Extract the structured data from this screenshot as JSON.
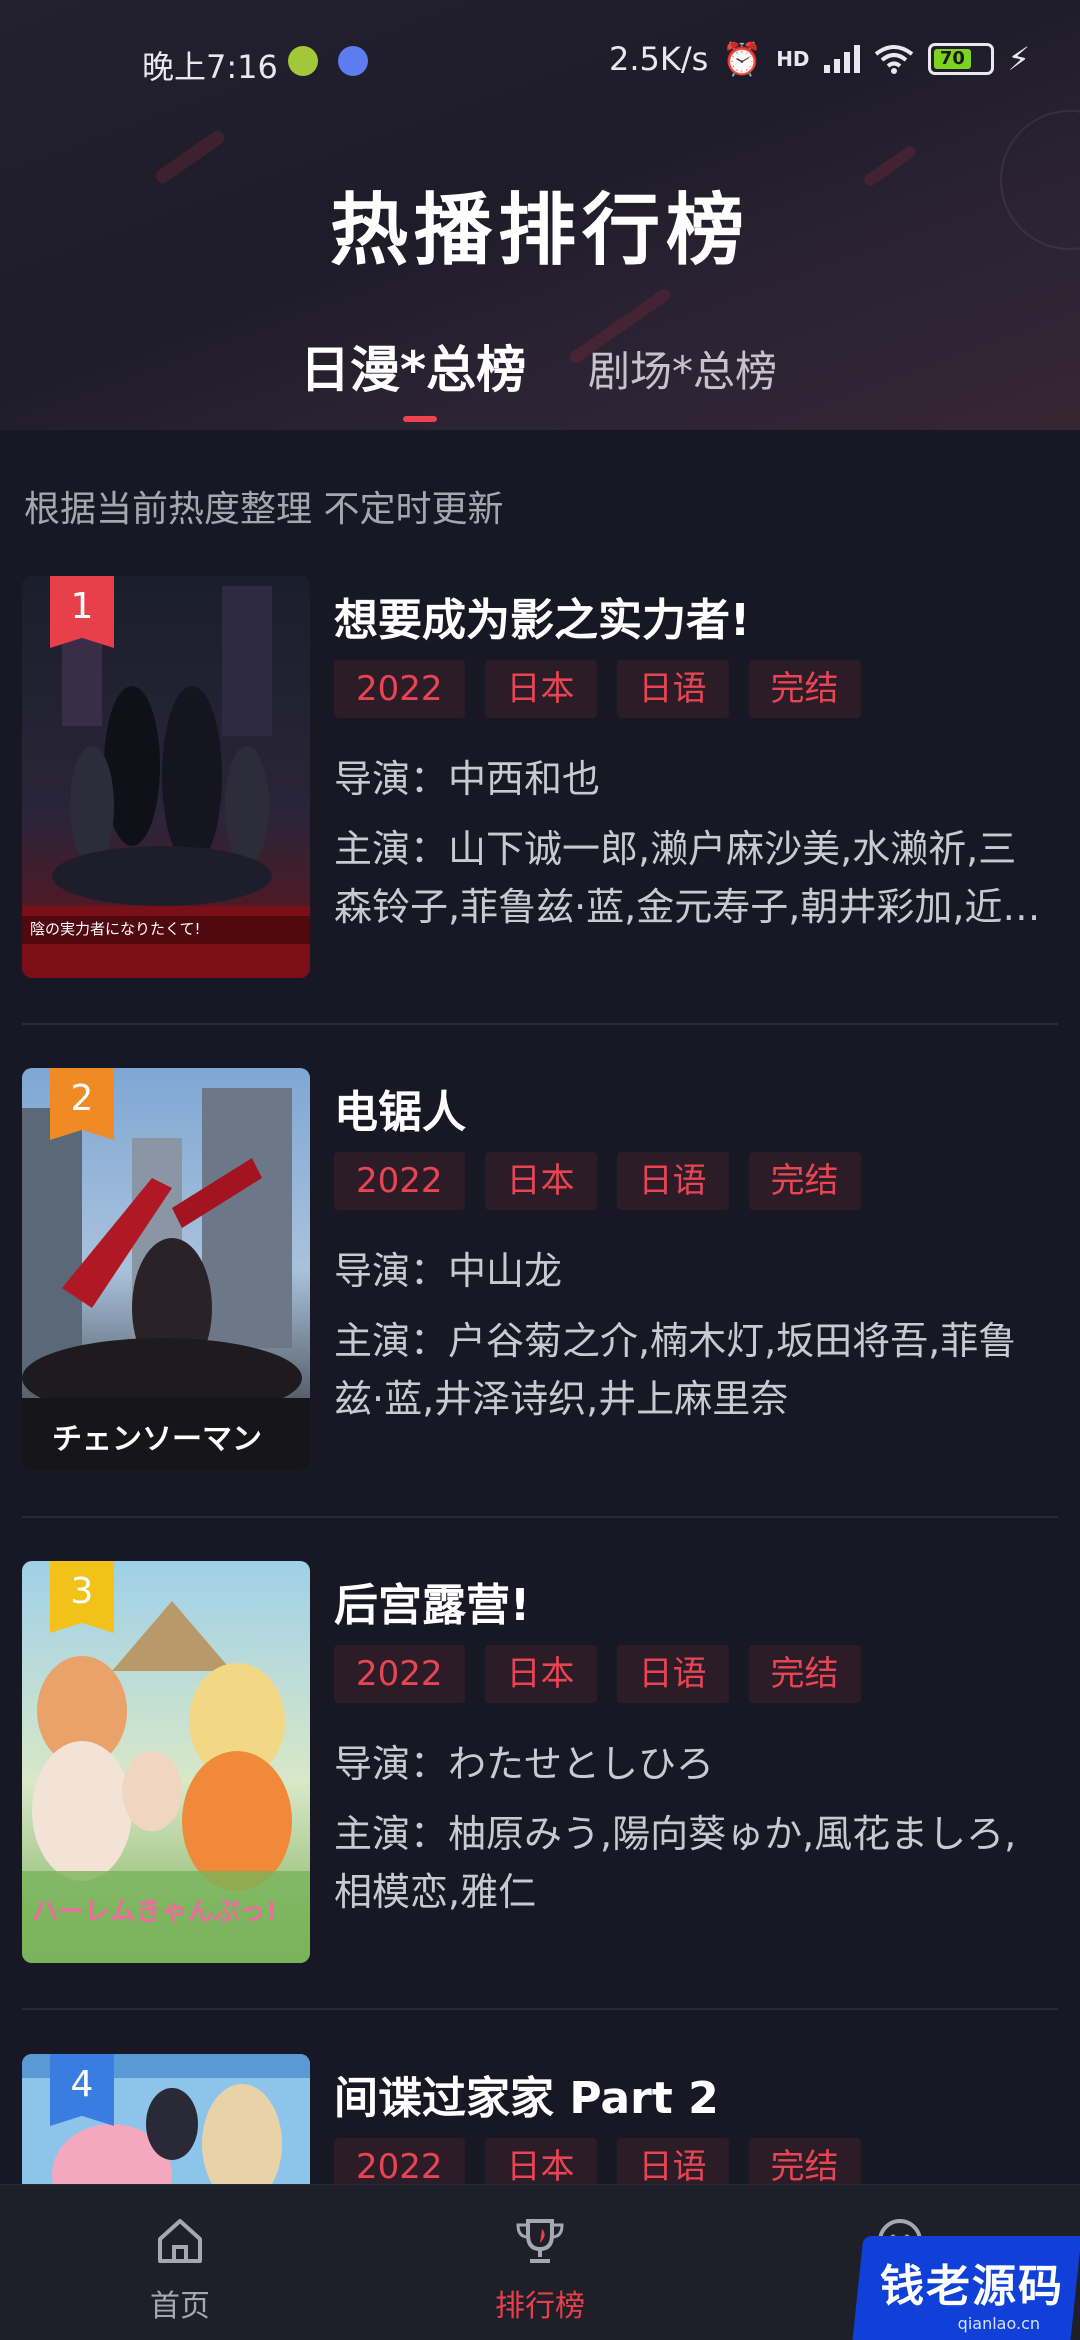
{
  "status_bar": {
    "time": "晚上7:16",
    "network_speed": "2.5K/s",
    "signal_label": "HD",
    "battery": "70"
  },
  "header": {
    "title": "热播排行榜",
    "tabs": [
      {
        "label": "日漫*总榜",
        "active": true
      },
      {
        "label": "剧场*总榜",
        "active": false
      }
    ]
  },
  "subtitle": "根据当前热度整理 不定时更新",
  "items": [
    {
      "rank": "1",
      "title": "想要成为影之实力者!",
      "tags": [
        "2022",
        "日本",
        "日语",
        "完结"
      ],
      "director": "导演：中西和也",
      "cast": "主演：山下诚一郎,濑户麻沙美,水濑祈,三森铃子,菲鲁兹·蓝,金元寿子,朝井彩加,近…",
      "cover_text": "陰の実力者になりたくて!"
    },
    {
      "rank": "2",
      "title": "电锯人",
      "tags": [
        "2022",
        "日本",
        "日语",
        "完结"
      ],
      "director": "导演：中山龙",
      "cast": "主演：户谷菊之介,楠木灯,坂田将吾,菲鲁兹·蓝,井泽诗织,井上麻里奈",
      "cover_text": "チェンソーマン"
    },
    {
      "rank": "3",
      "title": "后宫露营!",
      "tags": [
        "2022",
        "日本",
        "日语",
        "完结"
      ],
      "director": "导演：わたせとしひろ",
      "cast": "主演：柚原みう,陽向葵ゅか,風花ましろ,相模恋,雅仁",
      "cover_text": "ハーレムきゃんぷっ!"
    },
    {
      "rank": "4",
      "title": "间谍过家家 Part 2",
      "tags": [
        "2022",
        "日本",
        "日语",
        "完结"
      ],
      "director": "",
      "cast": "",
      "cover_text": ""
    }
  ],
  "bottom_nav": [
    {
      "label": "首页",
      "icon": "home-icon",
      "active": false
    },
    {
      "label": "排行榜",
      "icon": "trophy-icon",
      "active": true
    },
    {
      "label": "",
      "icon": "user-icon",
      "active": false
    }
  ],
  "watermark": {
    "text": "钱老源码",
    "sub": "qianlao.cn"
  },
  "colors": {
    "background": "#181824",
    "accent": "#f0424c",
    "tag_text": "#e84553",
    "rank_1": "#e8404a",
    "rank_2": "#f08a24",
    "rank_3": "#f2c21b",
    "rank_4": "#3a7de0"
  }
}
